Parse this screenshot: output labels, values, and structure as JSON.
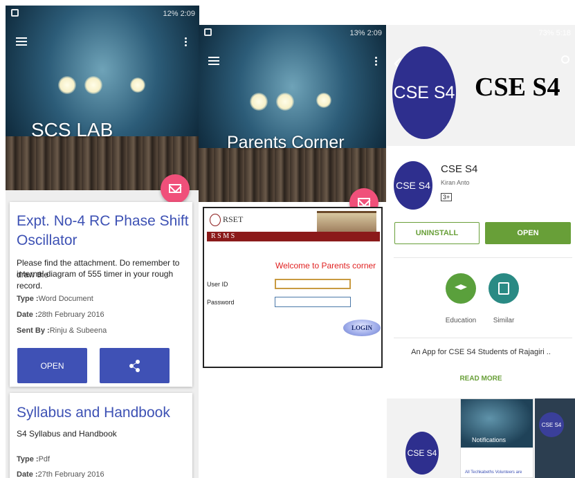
{
  "panel1": {
    "statusbar": "12% 2:09",
    "hero_title": "SCS LAB",
    "card1": {
      "title_line1": "Expt. No-4 RC Phase Shift",
      "title_line2": "Oscillator",
      "body_line1": "Please find the attachment. Do remember to draw the",
      "body_line2": "internal diagram of 555 timer in your rough record.",
      "type_label": "Type :",
      "type_value": "Word Document",
      "date_label": "Date :",
      "date_value": "28th February 2016",
      "sent_label": "Sent By :",
      "sent_value": "Rinju & Subeena",
      "open_label": "OPEN"
    },
    "card2": {
      "title": "Syllabus and Handbook",
      "subtitle": "S4 Syllabus and Handbook",
      "type_label": "Type :",
      "type_value": "Pdf",
      "date_label": "Date :",
      "date_value": "27th February 2016"
    }
  },
  "panel2": {
    "statusbar": "13% 2:09",
    "hero_title": "Parents Corner",
    "logo_text": "RSET",
    "bar_text": "R S M S",
    "welcome": "Welcome to Parents corner",
    "userid_label": "User ID",
    "password_label": "Password",
    "login_label": "LOGIN"
  },
  "panel3": {
    "statusbar": "73% 5:18",
    "banner_logo": "CSE S4",
    "banner_text": "CSE S4",
    "app_icon": "CSE S4",
    "app_name": "CSE S4",
    "developer": "Kiran Anto",
    "rating": "3+",
    "uninstall_label": "UNINSTALL",
    "open_label": "OPEN",
    "cat1_label": "Education",
    "cat2_label": "Similar",
    "description": "An App for CSE S4 Students of Rajagiri ..",
    "read_more": "READ MORE",
    "shot_icon": "CSE S4",
    "shot1_title": "Notifications",
    "shot1_caption": "All Techkabeths Volunteers are",
    "shot2_logo": "CSE S4"
  }
}
